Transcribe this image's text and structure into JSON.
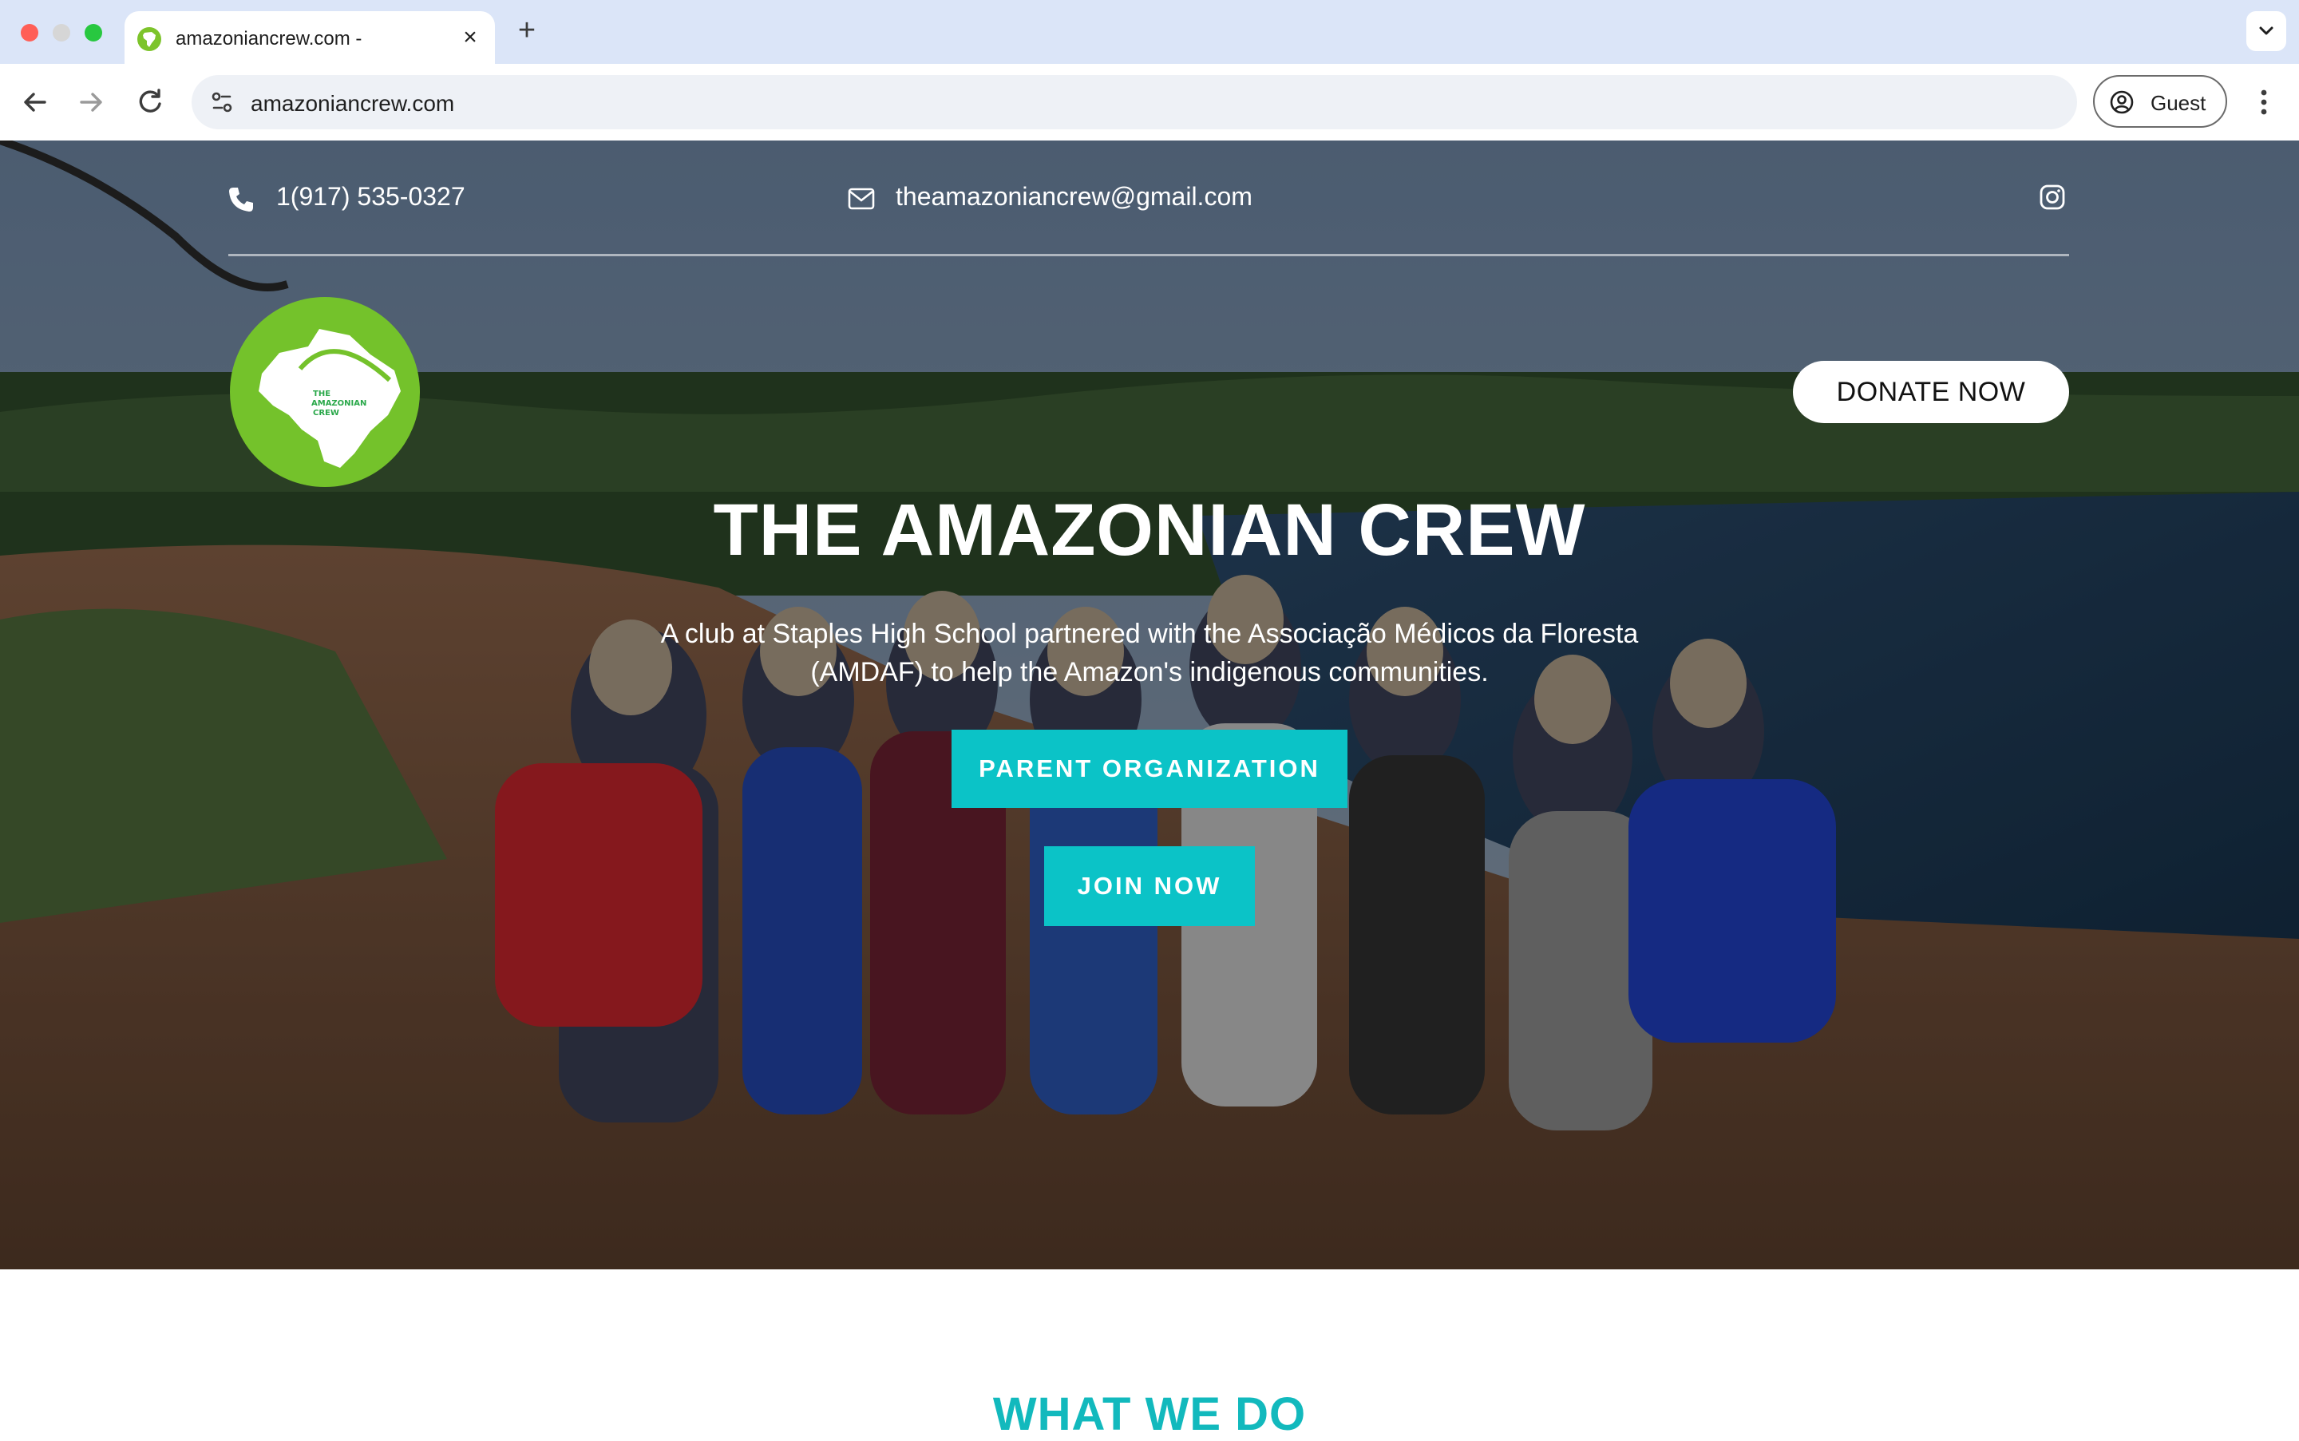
{
  "browser": {
    "tab_title": "amazoniancrew.com -",
    "tab_close_glyph": "×",
    "new_tab_glyph": "+",
    "url": "amazoniancrew.com",
    "profile_label": "Guest"
  },
  "topbar": {
    "phone": "1(917) 535-0327",
    "email": "theamazoniancrew@gmail.com"
  },
  "logo_text": [
    "THE",
    "AMAZONIAN",
    "CREW"
  ],
  "hero": {
    "donate_label": "DONATE NOW",
    "title": "THE AMAZONIAN CREW",
    "subtitle": "A club at Staples High School partnered with the Associação Médicos da Floresta (AMDAF) to help the Amazon's indigenous communities.",
    "parent_org_label": "PARENT ORGANIZATION",
    "join_label": "JOIN NOW"
  },
  "section": {
    "heading": "WHAT WE DO"
  },
  "colors": {
    "accent": "#0bc3c7",
    "logo_green": "#74c22b",
    "tabbar": "#dbe5f8"
  }
}
